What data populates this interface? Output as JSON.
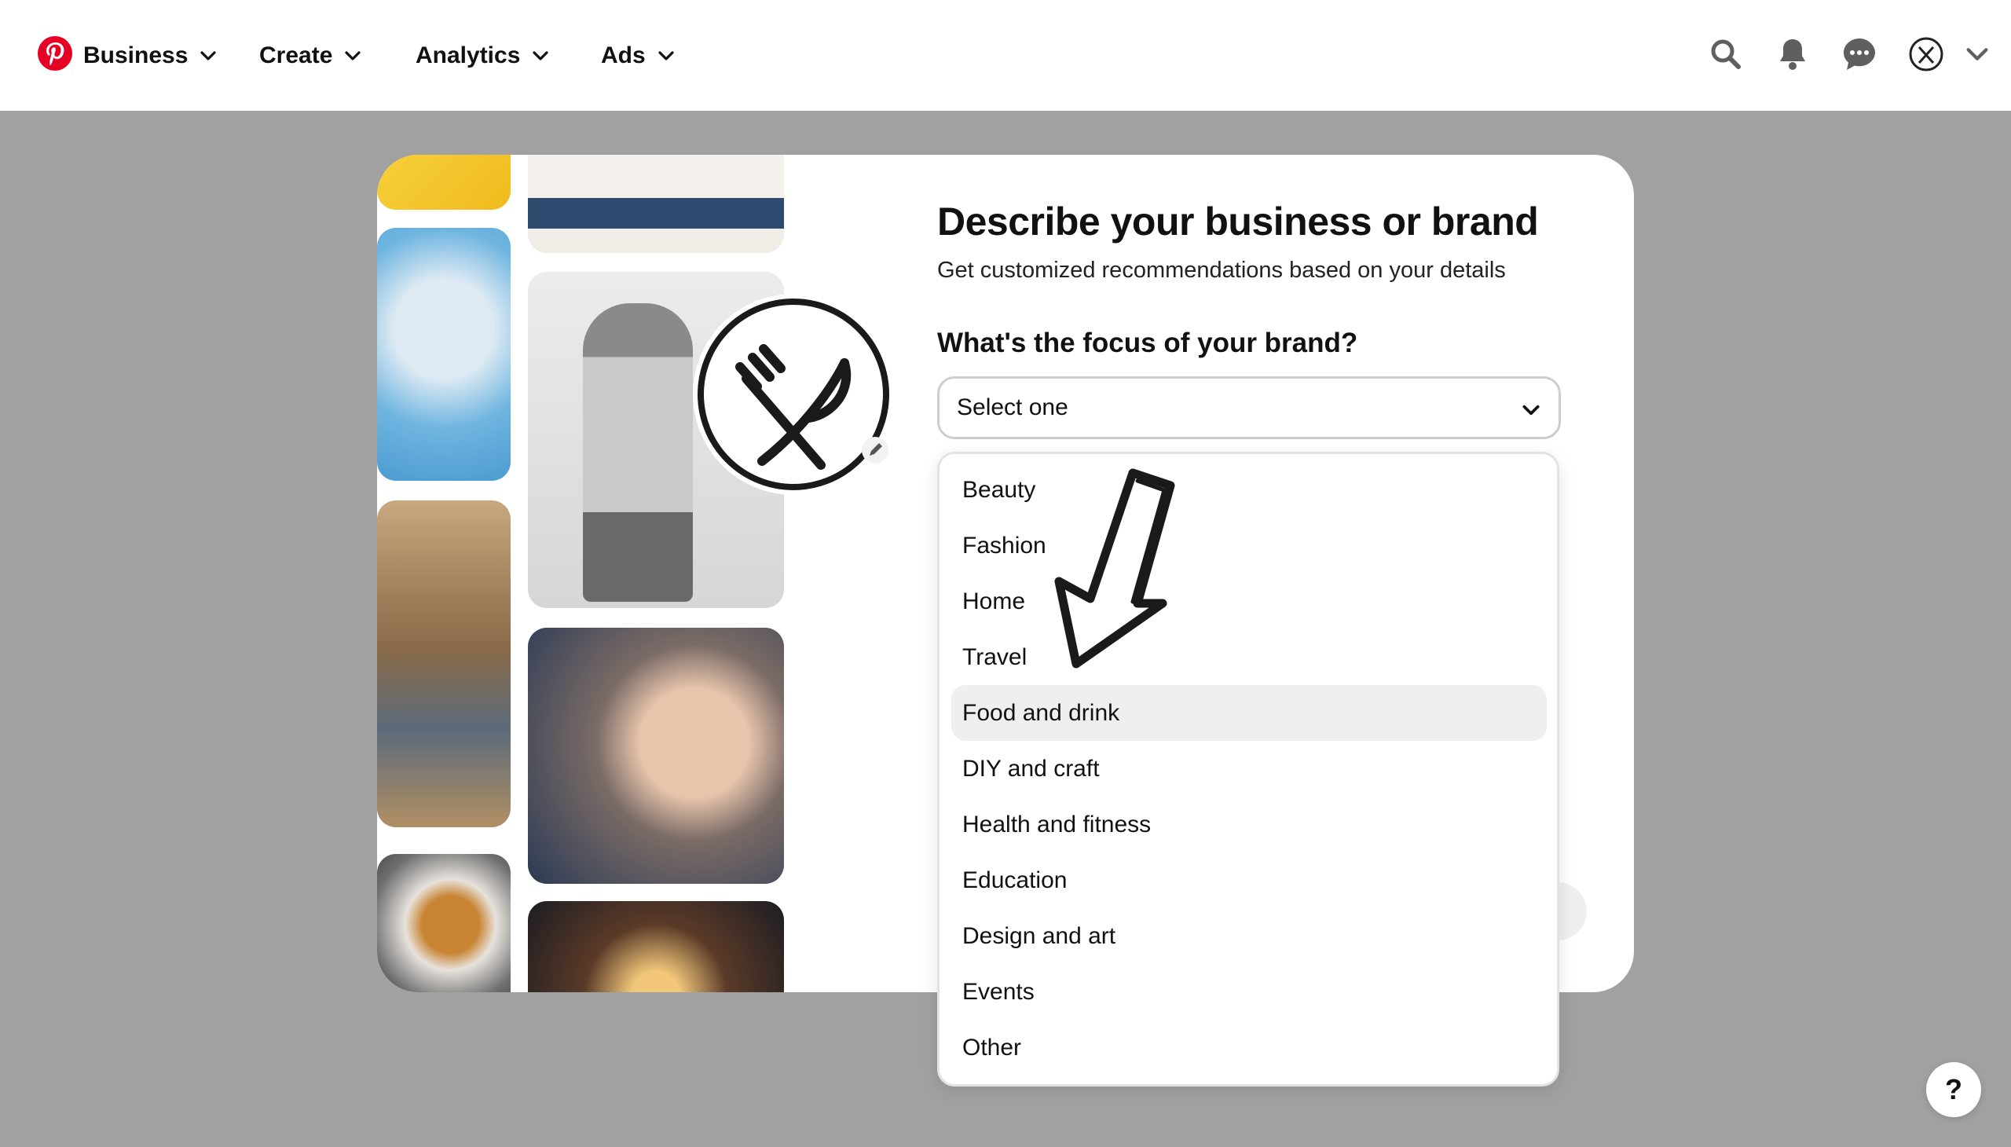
{
  "nav": {
    "business_label": "Business",
    "create_label": "Create",
    "analytics_label": "Analytics",
    "ads_label": "Ads",
    "icons": [
      "pinterest-logo",
      "search-icon",
      "notifications-icon",
      "messages-icon",
      "profile-avatar",
      "account-chevron-icon"
    ]
  },
  "modal": {
    "title": "Describe your business or brand",
    "subtitle": "Get customized recommendations based on your details",
    "question": "What's the focus of your brand?",
    "select_value": "Select one"
  },
  "dropdown": {
    "options": [
      {
        "label": "Beauty"
      },
      {
        "label": "Fashion"
      },
      {
        "label": "Home"
      },
      {
        "label": "Travel"
      },
      {
        "label": "Food and drink"
      },
      {
        "label": "DIY and craft"
      },
      {
        "label": "Health and fitness"
      },
      {
        "label": "Education"
      },
      {
        "label": "Design and art"
      },
      {
        "label": "Events"
      },
      {
        "label": "Other"
      }
    ],
    "highlighted": "Food and drink"
  },
  "help_label": "?",
  "colors": {
    "brand_red": "#e60023",
    "overlay_gray": "#a1a1a1",
    "highlight_gray": "#efefef"
  }
}
